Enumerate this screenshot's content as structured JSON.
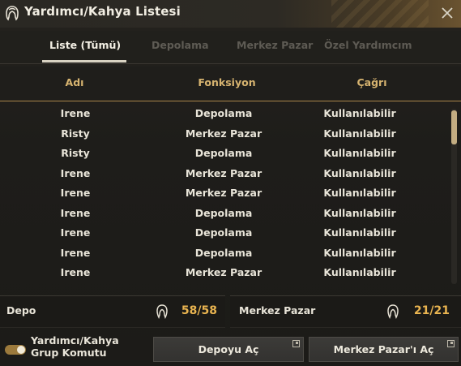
{
  "window": {
    "title": "Yardımcı/Kahya Listesi",
    "title_icon": "maid-head-icon",
    "close_icon": "close-icon"
  },
  "tabs": [
    {
      "label": "Liste (Tümü)",
      "active": true
    },
    {
      "label": "Depolama",
      "active": false
    },
    {
      "label": "Merkez Pazar",
      "active": false
    },
    {
      "label": "Özel Yardımcım",
      "active": false
    }
  ],
  "table": {
    "headers": [
      "Adı",
      "Fonksiyon",
      "Çağrı"
    ],
    "rows": [
      [
        "Irene",
        "Depolama",
        "Kullanılabilir"
      ],
      [
        "Risty",
        "Merkez Pazar",
        "Kullanılabilir"
      ],
      [
        "Risty",
        "Depolama",
        "Kullanılabilir"
      ],
      [
        "Irene",
        "Merkez Pazar",
        "Kullanılabilir"
      ],
      [
        "Irene",
        "Merkez Pazar",
        "Kullanılabilir"
      ],
      [
        "Irene",
        "Depolama",
        "Kullanılabilir"
      ],
      [
        "Irene",
        "Depolama",
        "Kullanılabilir"
      ],
      [
        "Irene",
        "Depolama",
        "Kullanılabilir"
      ],
      [
        "Irene",
        "Merkez Pazar",
        "Kullanılabilir"
      ]
    ]
  },
  "storage": {
    "label": "Depo",
    "count": "58/58"
  },
  "market": {
    "label": "Merkez Pazar",
    "count": "21/21"
  },
  "footer": {
    "toggle_label": "Yardımcı/Kahya Grup Komutu",
    "toggle_on": true,
    "open_storage_label": "Depoyu Aç",
    "open_market_label": "Merkez Pazar'ı Aç"
  },
  "colors": {
    "accent": "#e9b450",
    "header_text": "#d7b470",
    "active_tab": "#f3efe4",
    "inactive_tab": "#5e5b54"
  }
}
